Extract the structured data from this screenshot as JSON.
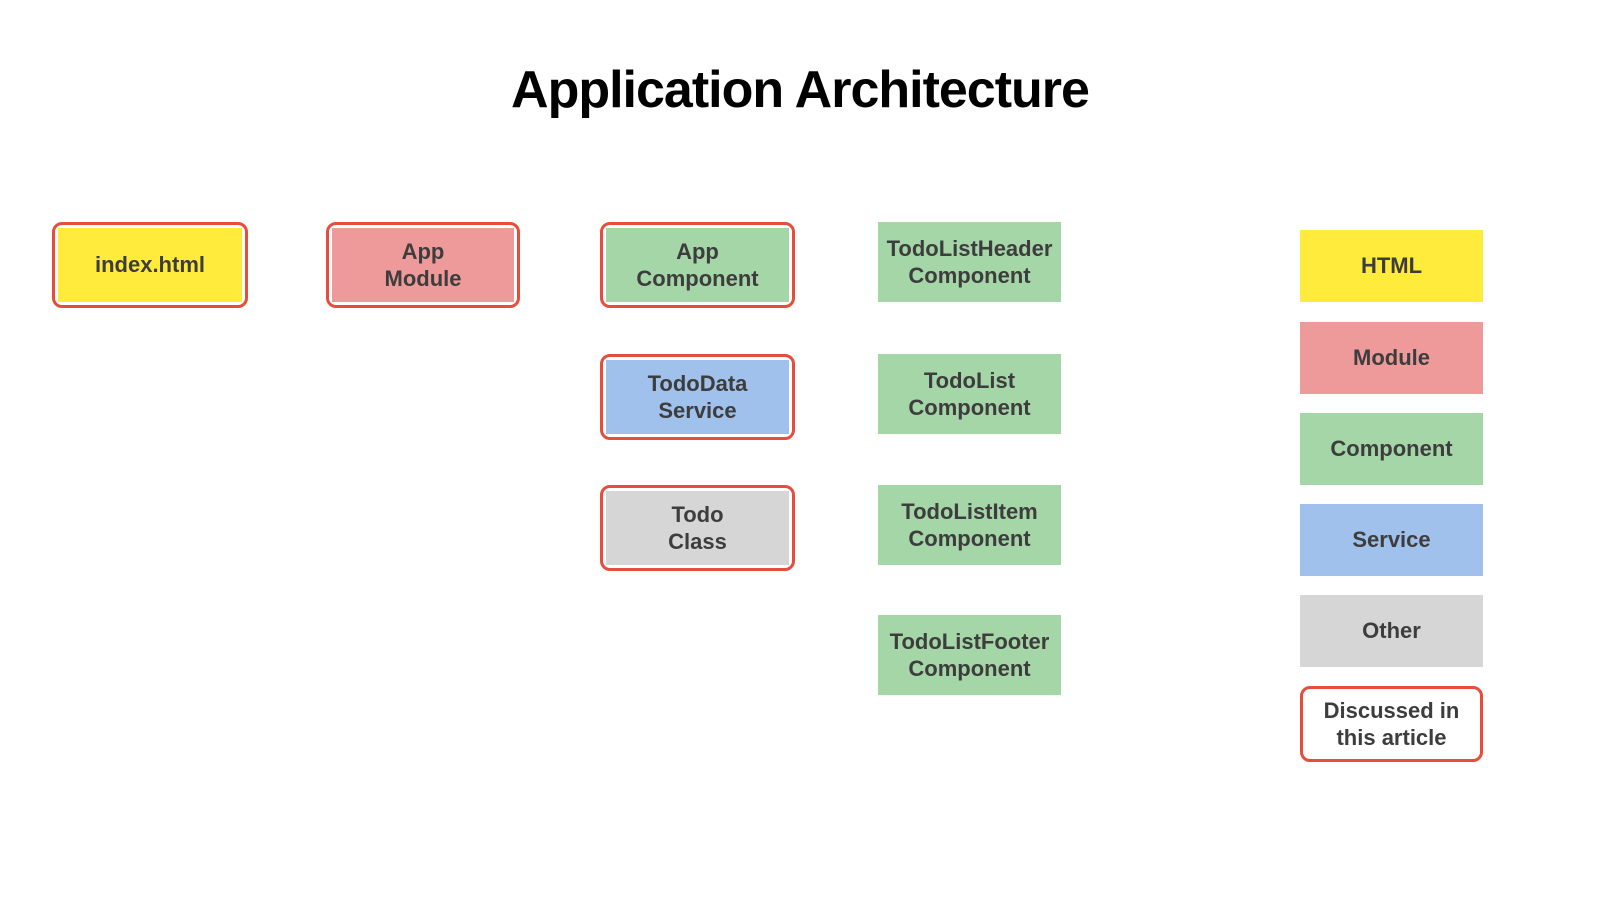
{
  "title": "Application Architecture",
  "columns": {
    "col1": {
      "box1": "index.html"
    },
    "col2": {
      "box1": "App\nModule"
    },
    "col3": {
      "box1": "App\nComponent",
      "box2": "TodoData\nService",
      "box3": "Todo\nClass"
    },
    "col4": {
      "box1": "TodoListHeader\nComponent",
      "box2": "TodoList\nComponent",
      "box3": "TodoListItem\nComponent",
      "box4": "TodoListFooter\nComponent"
    }
  },
  "legend": {
    "html": "HTML",
    "module": "Module",
    "component": "Component",
    "service": "Service",
    "other": "Other",
    "discussed": "Discussed in\nthis article"
  },
  "colors": {
    "html": "#ffeb3b",
    "module": "#ef9a9a",
    "component": "#a5d6a7",
    "service": "#9fc1ec",
    "other": "#d6d6d6",
    "outline": "#e74c3c"
  }
}
